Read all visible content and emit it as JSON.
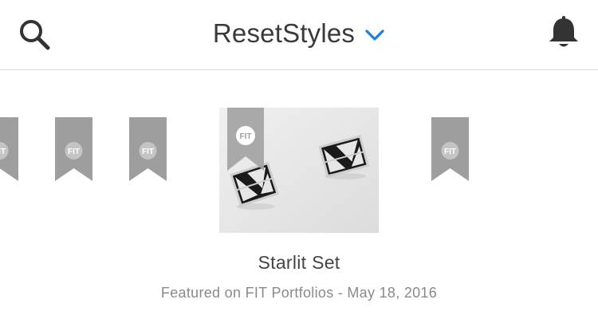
{
  "header": {
    "title": "ResetStyles",
    "search_icon": "search-icon",
    "dropdown_icon": "chevron-down-icon",
    "notifications_icon": "bell-icon",
    "accent_color": "#1a7fe0"
  },
  "carousel": {
    "ribbon_label": "FIT",
    "ribbon_color": "#9e9e9e",
    "featured": {
      "badge_label": "FIT",
      "title": "Starlit Set",
      "meta": "Featured on FIT Portfolios - May 18, 2016"
    }
  }
}
